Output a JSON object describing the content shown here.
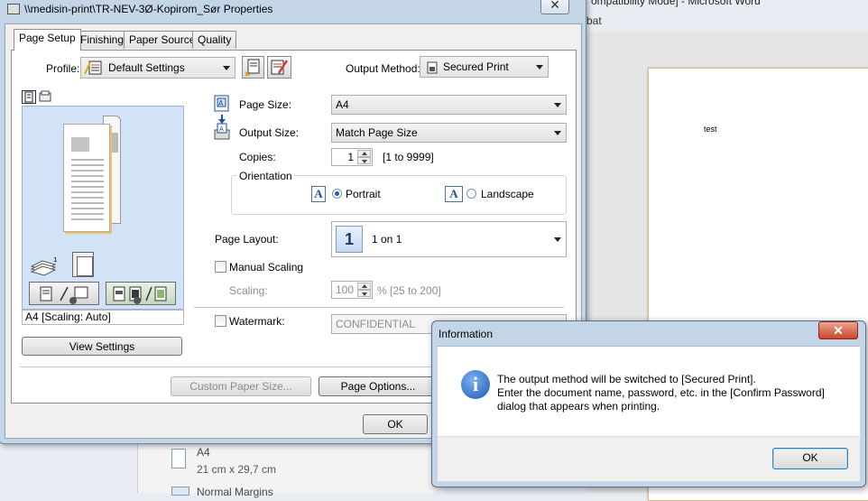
{
  "word": {
    "title_fragment": "ompatibility Mode] - Microsoft Word",
    "ribbon_fragment": "bat",
    "doc_text": "test",
    "paper_item": {
      "name": "A4",
      "size": "21 cm x 29,7 cm"
    },
    "margins_item": "Normal Margins"
  },
  "props": {
    "title": "\\\\medisin-print\\TR-NEV-3Ø-Kopirom_Sør Properties",
    "close_glyph": "✕",
    "tabs": [
      "Page Setup",
      "Finishing",
      "Paper Source",
      "Quality"
    ],
    "profile": {
      "label": "Profile:",
      "value": "Default Settings"
    },
    "output_method": {
      "label": "Output Method:",
      "value": "Secured Print"
    },
    "page_size": {
      "label": "Page Size:",
      "value": "A4"
    },
    "output_size": {
      "label": "Output Size:",
      "value": "Match Page Size"
    },
    "copies": {
      "label": "Copies:",
      "value": "1",
      "range": "[1 to 9999]"
    },
    "orientation": {
      "label": "Orientation",
      "portrait": "Portrait",
      "landscape": "Landscape",
      "selected": "Portrait",
      "icon_letter": "A"
    },
    "page_layout": {
      "label": "Page Layout:",
      "icon": "1",
      "value": "1 on 1"
    },
    "manual_scaling": {
      "label": "Manual Scaling",
      "checked": false
    },
    "scaling": {
      "label": "Scaling:",
      "value": "100",
      "range": "% [25 to 200]"
    },
    "watermark": {
      "label": "Watermark:",
      "checked": false,
      "value": "CONFIDENTIAL"
    },
    "preview_status": "A4 [Scaling: Auto]",
    "view_settings": "View Settings",
    "custom_paper_size": "Custom Paper Size...",
    "page_options": "Page Options...",
    "ok": "OK"
  },
  "info": {
    "title": "Information",
    "close_glyph": "✕",
    "icon_letter": "i",
    "lines": [
      "The output method will be switched to [Secured Print].",
      "Enter the document name, password, etc. in the [Confirm Password]",
      "dialog that appears when printing."
    ],
    "ok": "OK"
  },
  "colors": {
    "dialog_frame": "#c5d5e8",
    "preview_bg": "#d3e3f7",
    "info_icon": "#1a58b8",
    "close_red": "#c9452a"
  }
}
